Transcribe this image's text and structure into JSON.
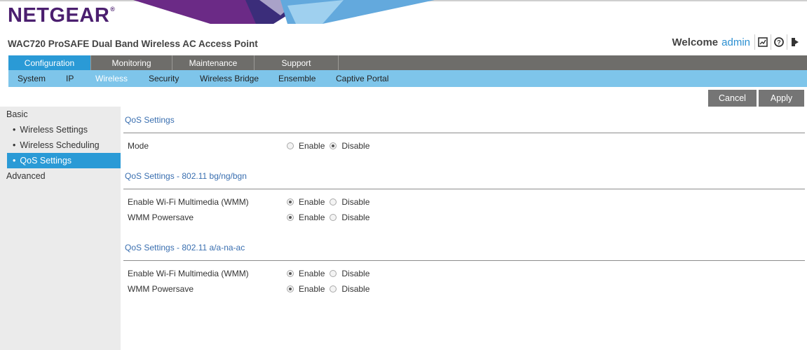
{
  "brand": {
    "logo_text": "NETGEAR",
    "logo_mark": "®"
  },
  "product_title": "WAC720 ProSAFE Dual Band Wireless AC Access Point",
  "header": {
    "welcome_label": "Welcome",
    "username": "admin",
    "icons": [
      "logs-icon",
      "help-icon",
      "logout-icon"
    ]
  },
  "main_nav": {
    "tabs": [
      {
        "label": "Configuration",
        "active": true
      },
      {
        "label": "Monitoring",
        "active": false
      },
      {
        "label": "Maintenance",
        "active": false
      },
      {
        "label": "Support",
        "active": false
      }
    ]
  },
  "sub_nav": {
    "items": [
      {
        "label": "System",
        "active": false
      },
      {
        "label": "IP",
        "active": false
      },
      {
        "label": "Wireless",
        "active": true
      },
      {
        "label": "Security",
        "active": false
      },
      {
        "label": "Wireless Bridge",
        "active": false
      },
      {
        "label": "Ensemble",
        "active": false
      },
      {
        "label": "Captive Portal",
        "active": false
      }
    ]
  },
  "actions": {
    "cancel_label": "Cancel",
    "apply_label": "Apply"
  },
  "sidebar": {
    "basic_label": "Basic",
    "items": [
      {
        "label": "Wireless Settings",
        "active": false
      },
      {
        "label": "Wireless Scheduling",
        "active": false
      },
      {
        "label": "QoS Settings",
        "active": true
      }
    ],
    "advanced_label": "Advanced",
    "bullet": "•"
  },
  "qos": {
    "section_title": "QoS Settings",
    "mode_label": "Mode",
    "mode_value": "Disable",
    "bg": {
      "title": "QoS Settings - 802.11 bg/ng/bgn",
      "wmm_label": "Enable Wi-Fi Multimedia (WMM)",
      "wmm_value": "Enable",
      "powersave_label": "WMM Powersave",
      "powersave_value": "Enable"
    },
    "a": {
      "title": "QoS Settings - 802.11 a/a-na-ac",
      "wmm_label": "Enable Wi-Fi Multimedia (WMM)",
      "wmm_value": "Enable",
      "powersave_label": "WMM Powersave",
      "powersave_value": "Enable"
    },
    "option_enable": "Enable",
    "option_disable": "Disable"
  },
  "colors": {
    "brand_purple": "#4b1f6f",
    "nav_dark": "#6e6d6a",
    "nav_active": "#2a9ad6",
    "subnav_bg": "#7ec5ea",
    "section_title": "#3a6fb0"
  }
}
